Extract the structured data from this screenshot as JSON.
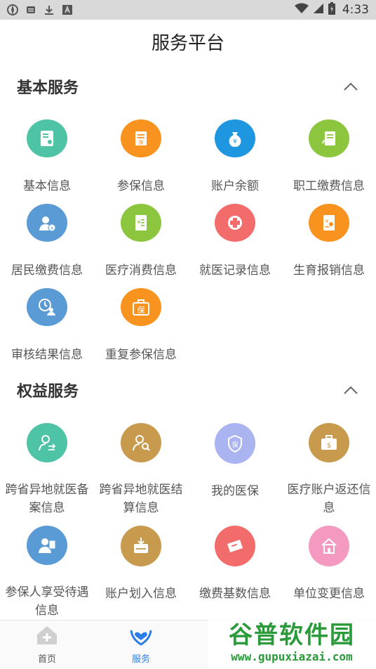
{
  "status_bar": {
    "time": "4:33",
    "icons": [
      "settings-icon",
      "message-icon",
      "download-icon",
      "font-icon",
      "wifi-icon",
      "signal-icon",
      "battery-icon"
    ]
  },
  "app": {
    "title": "服务平台"
  },
  "sections": {
    "basic": {
      "title": "基本服务",
      "items": [
        {
          "label": "基本信息",
          "color": "#4fc3a5",
          "icon": "id-card-icon"
        },
        {
          "label": "参保信息",
          "color": "#f7931e",
          "icon": "insurance-document-icon"
        },
        {
          "label": "账户余额",
          "color": "#1e96e0",
          "icon": "money-bag-icon"
        },
        {
          "label": "职工缴费信息",
          "color": "#8cc63f",
          "icon": "payment-document-icon"
        },
        {
          "label": "居民缴费信息",
          "color": "#5b9bd5",
          "icon": "resident-payment-icon"
        },
        {
          "label": "医疗消费信息",
          "color": "#8cc63f",
          "icon": "medical-expense-icon"
        },
        {
          "label": "就医记录信息",
          "color": "#f36c6c",
          "icon": "medical-cross-icon"
        },
        {
          "label": "生育报销信息",
          "color": "#f7931e",
          "icon": "maternity-reimbursement-icon"
        },
        {
          "label": "审核结果信息",
          "color": "#5b9bd5",
          "icon": "review-clock-icon"
        },
        {
          "label": "重复参保信息",
          "color": "#f7931e",
          "icon": "duplicate-insurance-icon"
        }
      ]
    },
    "rights": {
      "title": "权益服务",
      "items": [
        {
          "label": "跨省异地就医备案信息",
          "color": "#4fc3a5",
          "icon": "cross-province-record-icon"
        },
        {
          "label": "跨省异地就医结算信息",
          "color": "#c79a4e",
          "icon": "cross-province-settlement-icon"
        },
        {
          "label": "我的医保",
          "color": "#a9b4f0",
          "icon": "shield-icon"
        },
        {
          "label": "医疗账户返还信息",
          "color": "#c79a4e",
          "icon": "briefcase-dollar-icon"
        },
        {
          "label": "参保人享受待遇信息",
          "color": "#5b9bd5",
          "icon": "insured-benefit-icon"
        },
        {
          "label": "账户划入信息",
          "color": "#c79a4e",
          "icon": "transfer-in-icon"
        },
        {
          "label": "缴费基数信息",
          "color": "#f36c6c",
          "icon": "payment-base-icon"
        },
        {
          "label": "单位变更信息",
          "color": "#f49ac1",
          "icon": "house-icon"
        }
      ]
    }
  },
  "bottom_nav": [
    {
      "label": "首页",
      "icon": "home-icon",
      "active": false
    },
    {
      "label": "服务",
      "icon": "heart-hands-icon",
      "active": true
    }
  ],
  "watermark": {
    "name": "谷普软件园",
    "url": "www.gupuxiazai.com"
  }
}
